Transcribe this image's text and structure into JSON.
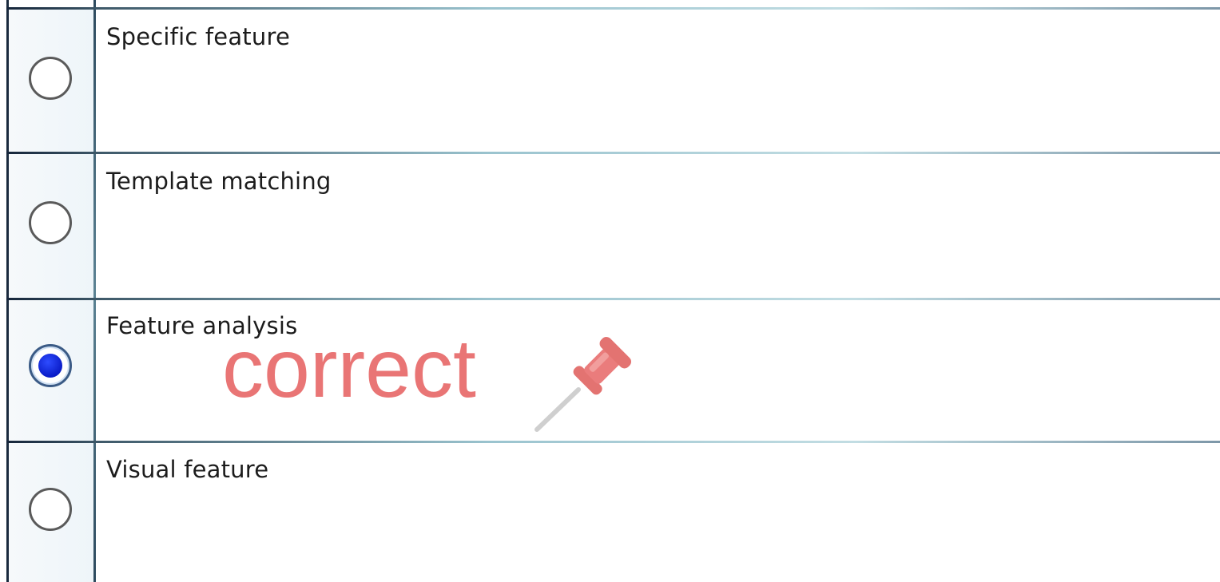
{
  "options": [
    {
      "label": "Specific feature",
      "selected": false
    },
    {
      "label": "Template matching",
      "selected": false
    },
    {
      "label": "Feature analysis",
      "selected": true
    },
    {
      "label": "Visual feature",
      "selected": false
    }
  ],
  "annotation": {
    "text": "correct",
    "pin_icon": "pushpin-icon",
    "color": "#e86a6a"
  },
  "colors": {
    "selected_radio": "#0a1cc8",
    "border": "#1a2a3e"
  }
}
